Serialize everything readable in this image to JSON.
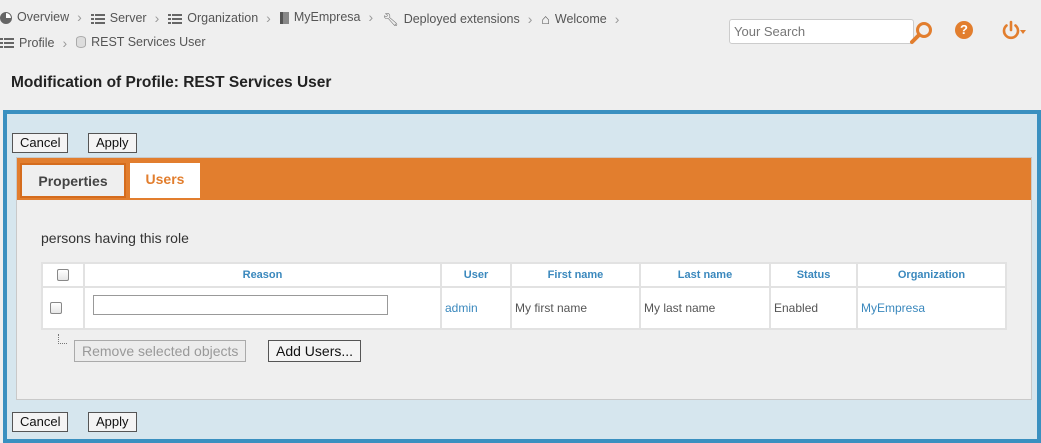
{
  "breadcrumb": {
    "items": [
      {
        "label": "Overview",
        "icon": "overview-icon"
      },
      {
        "label": "Server",
        "icon": "list-icon"
      },
      {
        "label": "Organization",
        "icon": "list-icon"
      },
      {
        "label": "MyEmpresa",
        "icon": "document-icon"
      },
      {
        "label": "Deployed extensions",
        "icon": "wrench-icon"
      },
      {
        "label": "Welcome",
        "icon": "home-icon"
      },
      {
        "label": "Profile",
        "icon": "list-icon"
      },
      {
        "label": "REST Services User",
        "icon": "database-icon"
      }
    ]
  },
  "header": {
    "search_placeholder": "Your Search",
    "help_symbol": "?",
    "accent_color": "#e27e2e"
  },
  "page": {
    "title": "Modification of Profile: REST Services User",
    "frame_color": "#3a90c0"
  },
  "actions": {
    "cancel": "Cancel",
    "apply": "Apply"
  },
  "tabs": [
    {
      "label": "Properties",
      "active": false
    },
    {
      "label": "Users",
      "active": true
    }
  ],
  "users_section": {
    "label": "persons having this role",
    "columns": [
      "Reason",
      "User",
      "First name",
      "Last name",
      "Status",
      "Organization"
    ],
    "rows": [
      {
        "reason": "",
        "user": "admin",
        "first_name": "My first name",
        "last_name": "My last name",
        "status": "Enabled",
        "organization": "MyEmpresa"
      }
    ],
    "remove_label": "Remove selected objects",
    "add_label": "Add Users..."
  }
}
